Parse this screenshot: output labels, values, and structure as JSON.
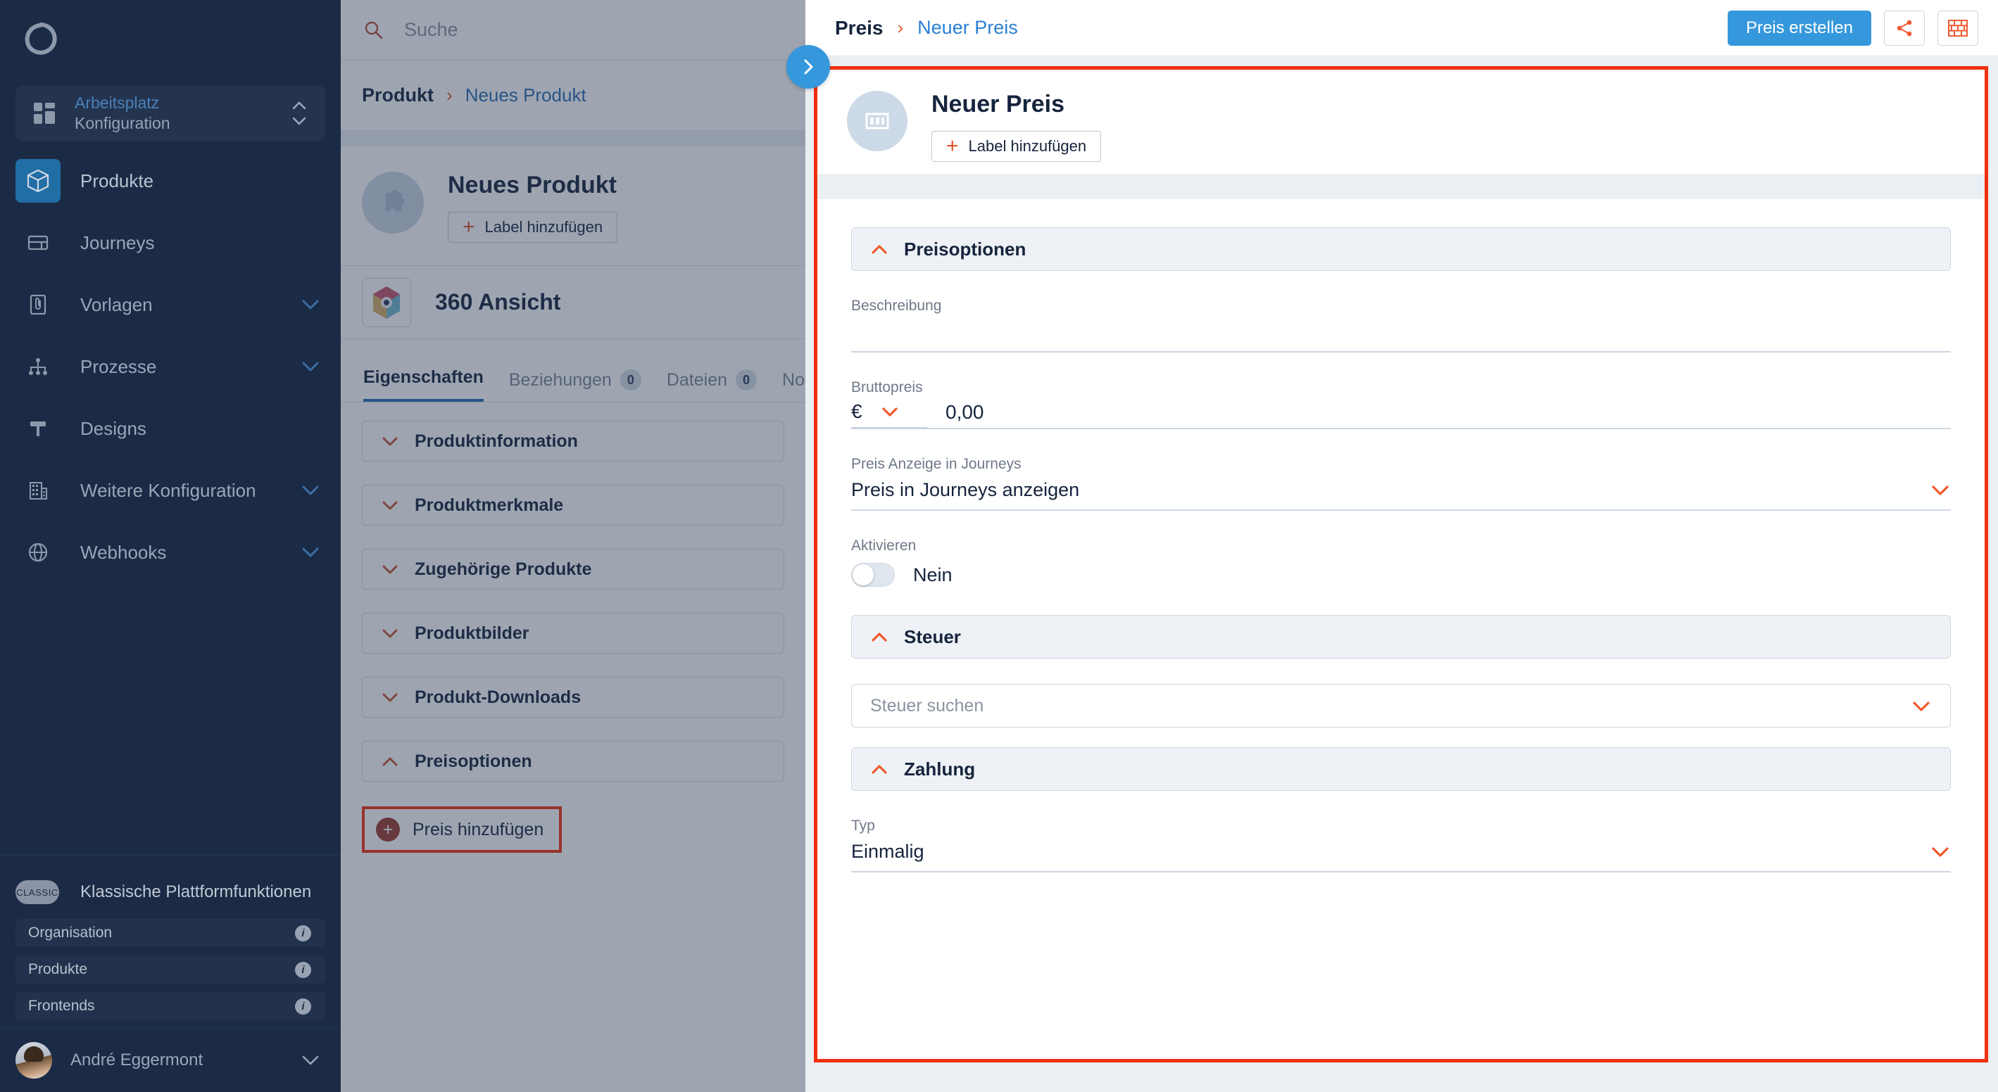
{
  "sidebar": {
    "logo_icon": "refresh-cycle-logo",
    "workspace": {
      "top_label": "Arbeitsplatz",
      "bottom_label": "Konfiguration",
      "icon": "grid-icon"
    },
    "items": [
      {
        "label": "Produkte",
        "icon": "cube-icon",
        "active": true,
        "chevron": false
      },
      {
        "label": "Journeys",
        "icon": "layout-icon",
        "active": false,
        "chevron": false
      },
      {
        "label": "Vorlagen",
        "icon": "document-clip-icon",
        "active": false,
        "chevron": true
      },
      {
        "label": "Prozesse",
        "icon": "hierarchy-icon",
        "active": false,
        "chevron": true
      },
      {
        "label": "Designs",
        "icon": "paint-roller-icon",
        "active": false,
        "chevron": false
      },
      {
        "label": "Weitere Konfiguration",
        "icon": "building-icon",
        "active": false,
        "chevron": true
      },
      {
        "label": "Webhooks",
        "icon": "globe-icon",
        "active": false,
        "chevron": true
      }
    ],
    "classic": {
      "pill": "CLASSIC",
      "title": "Klassische Plattformfunktionen",
      "items": [
        {
          "label": "Organisation",
          "info_icon": "info-icon"
        },
        {
          "label": "Produkte",
          "info_icon": "info-icon"
        },
        {
          "label": "Frontends",
          "info_icon": "info-icon"
        }
      ]
    },
    "user": {
      "name": "André Eggermont",
      "avatar": "user-avatar",
      "chevron": "chevron-down-icon"
    }
  },
  "middle": {
    "search": {
      "placeholder": "Suche",
      "icon": "search-icon"
    },
    "breadcrumb": {
      "parent": "Produkt",
      "separator": "›",
      "current": "Neues Produkt"
    },
    "header": {
      "title": "Neues Produkt",
      "add_label_button": "Label hinzufügen",
      "thumb_icon": "puzzle-piece-icon"
    },
    "view": {
      "title": "360 Ansicht",
      "icon": "hexagon-360-icon"
    },
    "tabs": [
      {
        "label": "Eigenschaften",
        "badge": null,
        "active": true
      },
      {
        "label": "Beziehungen",
        "badge": "0",
        "active": false
      },
      {
        "label": "Dateien",
        "badge": "0",
        "active": false
      },
      {
        "label": "No",
        "badge": null,
        "active": false
      }
    ],
    "accordions": [
      {
        "label": "Produktinformation",
        "expanded": false
      },
      {
        "label": "Produktmerkmale",
        "expanded": false
      },
      {
        "label": "Zugehörige Produkte",
        "expanded": false
      },
      {
        "label": "Produktbilder",
        "expanded": false
      },
      {
        "label": "Produkt-Downloads",
        "expanded": false
      },
      {
        "label": "Preisoptionen",
        "expanded": true
      }
    ],
    "add_price_button": "Preis hinzufügen"
  },
  "expand_fab": {
    "icon": "chevron-right-icon"
  },
  "right": {
    "breadcrumb": {
      "parent": "Preis",
      "separator": "›",
      "current": "Neuer Preis"
    },
    "create_button": "Preis erstellen",
    "share_button_icon": "share-icon",
    "blocks_button_icon": "brick-wall-icon",
    "header": {
      "title": "Neuer Preis",
      "add_label_button": "Label hinzufügen",
      "thumb_icon": "banknote-icon"
    },
    "sections": {
      "price_options": {
        "title": "Preisoptionen",
        "chevron": "chevron-up-icon",
        "fields": {
          "description": {
            "label": "Beschreibung",
            "value": ""
          },
          "gross_price": {
            "label": "Bruttopreis",
            "currency": "€",
            "currency_chevron": "chevron-down-icon",
            "value": "0,00"
          },
          "journey_display": {
            "label": "Preis Anzeige in Journeys",
            "value": "Preis in Journeys anzeigen",
            "chevron": "chevron-down-icon"
          },
          "activate": {
            "label": "Aktivieren",
            "toggle_state": "off",
            "toggle_text": "Nein"
          }
        }
      },
      "tax": {
        "title": "Steuer",
        "chevron": "chevron-up-icon",
        "search_placeholder": "Steuer suchen",
        "search_chevron": "chevron-down-icon"
      },
      "payment": {
        "title": "Zahlung",
        "chevron": "chevron-up-icon",
        "fields": {
          "type": {
            "label": "Typ",
            "value": "Einmalig",
            "chevron": "chevron-down-icon"
          }
        }
      }
    }
  },
  "colors": {
    "sidebar_bg": "#1b2b45",
    "accent_blue": "#3598dc",
    "accent_orange": "#f0592b",
    "highlight_red": "#f0300e",
    "link_blue": "#2a7fd4"
  }
}
